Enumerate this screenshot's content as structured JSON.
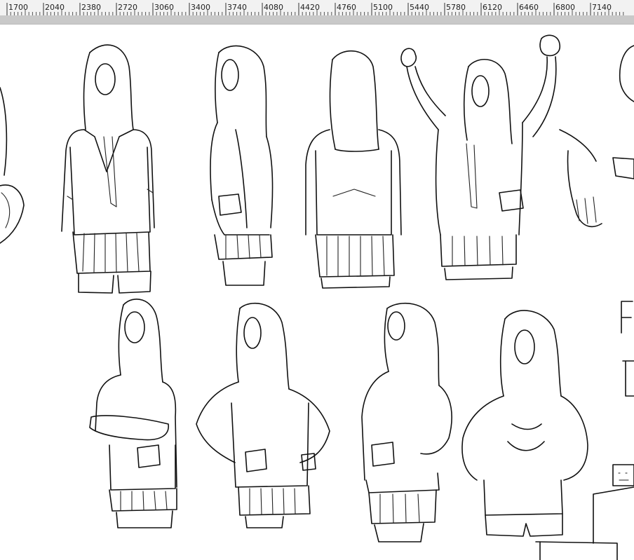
{
  "ruler": {
    "labels": [
      "1700",
      "2040",
      "2380",
      "2720",
      "3060",
      "3400",
      "3740",
      "4080",
      "4420",
      "4760",
      "5100",
      "5440",
      "5780",
      "6120",
      "6460",
      "6800",
      "7140"
    ]
  },
  "colors": {
    "ruler_bg": "#f2f2f2",
    "scroll_strip": "#c9c9c9",
    "canvas": "#ffffff",
    "ink": "#111111"
  },
  "canvas": {
    "content": "pencil line-art sketches of schoolgirl poses in blazer uniforms"
  }
}
